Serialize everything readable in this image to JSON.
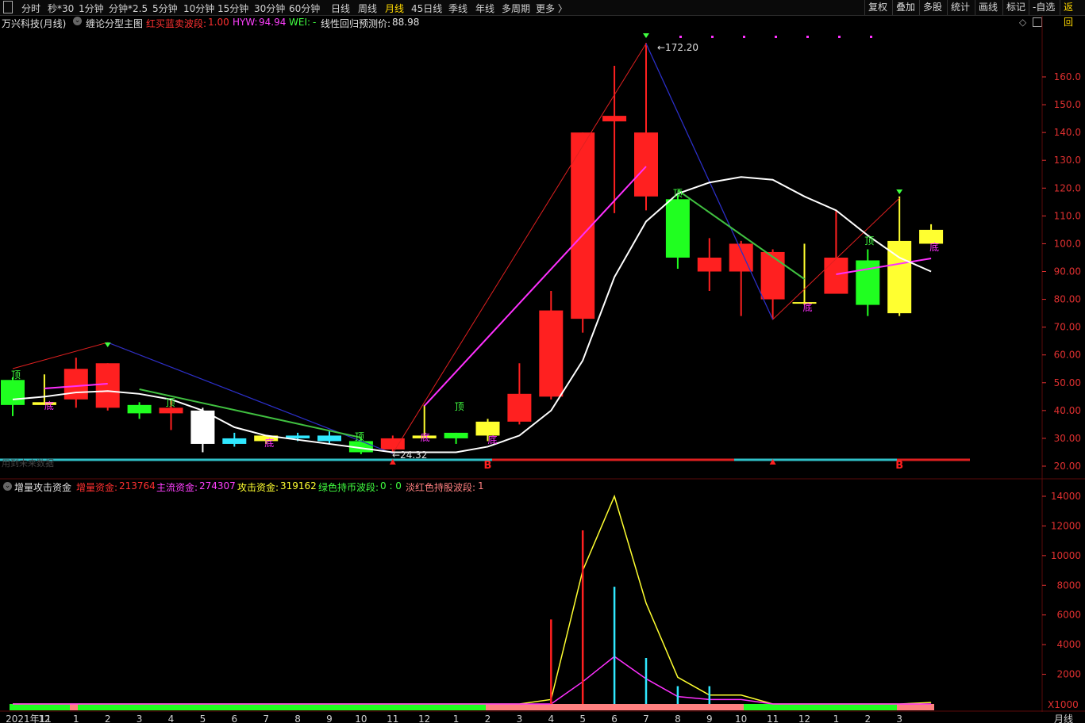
{
  "toolbar": {
    "items": [
      "分时",
      "秒*30",
      "1分钟",
      "分钟*2.5",
      "5分钟",
      "10分钟",
      "15分钟",
      "30分钟",
      "60分钟",
      "日线",
      "周线",
      "月线",
      "45日线",
      "季线",
      "年线",
      "多周期",
      "更多 〉"
    ],
    "active": "月线",
    "right": [
      "复权",
      "叠加",
      "多股",
      "统计",
      "画线",
      "标记",
      "-自选",
      "返回"
    ]
  },
  "main_header": {
    "stock": "万兴科技(月线)",
    "indicator": "缠论分型主图",
    "wave_label": "红买蓝卖波段:",
    "wave_value": "1.00",
    "hyw_label": "HYW:",
    "hyw_value": "94.94",
    "wei_label": "WEI:",
    "wei_value": "-",
    "reg_label": "线性回归预测价:",
    "reg_value": "88.98"
  },
  "indicator_header": {
    "name": "增量攻击资金",
    "incr_label": "增量资金:",
    "incr_value": "213764",
    "main_label": "主流资金:",
    "main_value": "274307",
    "attack_label": "攻击资金:",
    "attack_value": "319162",
    "green_label": "绿色持币波段:",
    "green_value": "0 : 0",
    "pink_label": "淡红色持股波段:",
    "pink_value": "1"
  },
  "colors": {
    "up": "#ff2020",
    "down": "#20ff20",
    "axis": "#e03030",
    "white_line": "#ffffff",
    "magenta": "#ff30ff",
    "yellow": "#ffff30",
    "cyan": "#30e8ff"
  },
  "chart_data": [
    {
      "type": "candlestick",
      "title": "万兴科技(月线)",
      "x": [
        "2021年11",
        "12",
        "1",
        "2",
        "3",
        "4",
        "5",
        "6",
        "7",
        "8",
        "9",
        "10",
        "11",
        "12",
        "1",
        "2",
        "3",
        "4",
        "5",
        "6",
        "7",
        "8",
        "9",
        "10",
        "11",
        "12",
        "1",
        "2",
        "3"
      ],
      "ohlc": [
        [
          42,
          52,
          38,
          51,
          "g"
        ],
        [
          43,
          53,
          42,
          42,
          "y"
        ],
        [
          44,
          59,
          41,
          55,
          "r"
        ],
        [
          41,
          57,
          40,
          57,
          "r"
        ],
        [
          42,
          43,
          37,
          39,
          "g"
        ],
        [
          39,
          44,
          33,
          41,
          "r"
        ],
        [
          40,
          41,
          25,
          28,
          "w"
        ],
        [
          30,
          32,
          27,
          28,
          "c"
        ],
        [
          31,
          31,
          28,
          29,
          "y"
        ],
        [
          31,
          32,
          29,
          30,
          "c"
        ],
        [
          31,
          33,
          28,
          29,
          "c"
        ],
        [
          29,
          30,
          24.32,
          25,
          "g"
        ],
        [
          26,
          31,
          25,
          30,
          "r"
        ],
        [
          31,
          42,
          30,
          30,
          "y"
        ],
        [
          30,
          32,
          28,
          32,
          "g"
        ],
        [
          31,
          37,
          29,
          36,
          "y"
        ],
        [
          36,
          57,
          35,
          46,
          "r"
        ],
        [
          45,
          83,
          44,
          76,
          "r"
        ],
        [
          73,
          140,
          68,
          140,
          "r"
        ],
        [
          144,
          164,
          111,
          146,
          "r"
        ],
        [
          117,
          172.2,
          112,
          140,
          "r"
        ],
        [
          116,
          118,
          91,
          95,
          "g"
        ],
        [
          90,
          102,
          83,
          95,
          "r"
        ],
        [
          90,
          101,
          74,
          100,
          "r"
        ],
        [
          80,
          98,
          73,
          97,
          "r"
        ],
        [
          79,
          100,
          78,
          79,
          "y"
        ],
        [
          82,
          112,
          82,
          95,
          "r"
        ],
        [
          78,
          98,
          74,
          94,
          "g"
        ],
        [
          75,
          117,
          74,
          101,
          "y"
        ],
        [
          100,
          107,
          100,
          105,
          "y"
        ]
      ],
      "annotations": [
        "172.20",
        "24.32",
        "顶",
        "底",
        "B"
      ],
      "ylim": [
        20,
        175
      ],
      "yticks": [
        "20.00",
        "30.00",
        "40.00",
        "50.00",
        "60.00",
        "70.00",
        "80.00",
        "90.00",
        "100.0",
        "110.0",
        "120.0",
        "130.0",
        "140.0",
        "150.0",
        "160.0"
      ],
      "white_ma": [
        44,
        45,
        46.5,
        47,
        46,
        44,
        40,
        34,
        31,
        29.5,
        28,
        26.5,
        25,
        25,
        25,
        27,
        31,
        40,
        58,
        88,
        108,
        118,
        122,
        124,
        123,
        117,
        112,
        103,
        95,
        90
      ],
      "overlay_text": "用到未来数据"
    },
    {
      "type": "line",
      "title": "增量攻击资金",
      "x": [
        "2021年11",
        "12",
        "1",
        "2",
        "3",
        "4",
        "5",
        "6",
        "7",
        "8",
        "9",
        "10",
        "11",
        "12",
        "1",
        "2",
        "3",
        "4",
        "5",
        "6",
        "7",
        "8",
        "9",
        "10",
        "11",
        "12",
        "1",
        "2",
        "3"
      ],
      "series": [
        {
          "name": "攻击资金",
          "values": [
            0,
            0,
            0,
            0,
            0,
            0,
            0,
            0,
            0,
            0,
            0,
            0,
            0,
            0,
            0,
            0,
            0,
            300,
            9000,
            14000,
            6800,
            1800,
            600,
            600,
            0,
            0,
            0,
            0,
            0,
            100
          ]
        },
        {
          "name": "主流资金",
          "values": [
            0,
            0,
            0,
            0,
            0,
            0,
            0,
            0,
            0,
            0,
            0,
            0,
            0,
            0,
            0,
            0,
            0,
            0,
            1500,
            3200,
            1700,
            500,
            300,
            300,
            0,
            0,
            0,
            0,
            0,
            0
          ]
        }
      ],
      "bars": [
        {
          "x": "4",
          "value": 5700,
          "color": "#ff2020"
        },
        {
          "x": "5",
          "value": 11700,
          "color": "#ff2020"
        },
        {
          "x": "6",
          "value": 7900,
          "color": "#30e8ff"
        },
        {
          "x": "7",
          "value": 3100,
          "color": "#30e8ff"
        },
        {
          "x": "8",
          "value": 1200,
          "color": "#30e8ff"
        },
        {
          "x": "9",
          "value": 1200,
          "color": "#30e8ff"
        }
      ],
      "ylim": [
        0,
        14500
      ],
      "yticks": [
        "2000",
        "4000",
        "6000",
        "8000",
        "10000",
        "12000",
        "14000"
      ],
      "unit": "X1000",
      "period_label": "月线"
    }
  ]
}
